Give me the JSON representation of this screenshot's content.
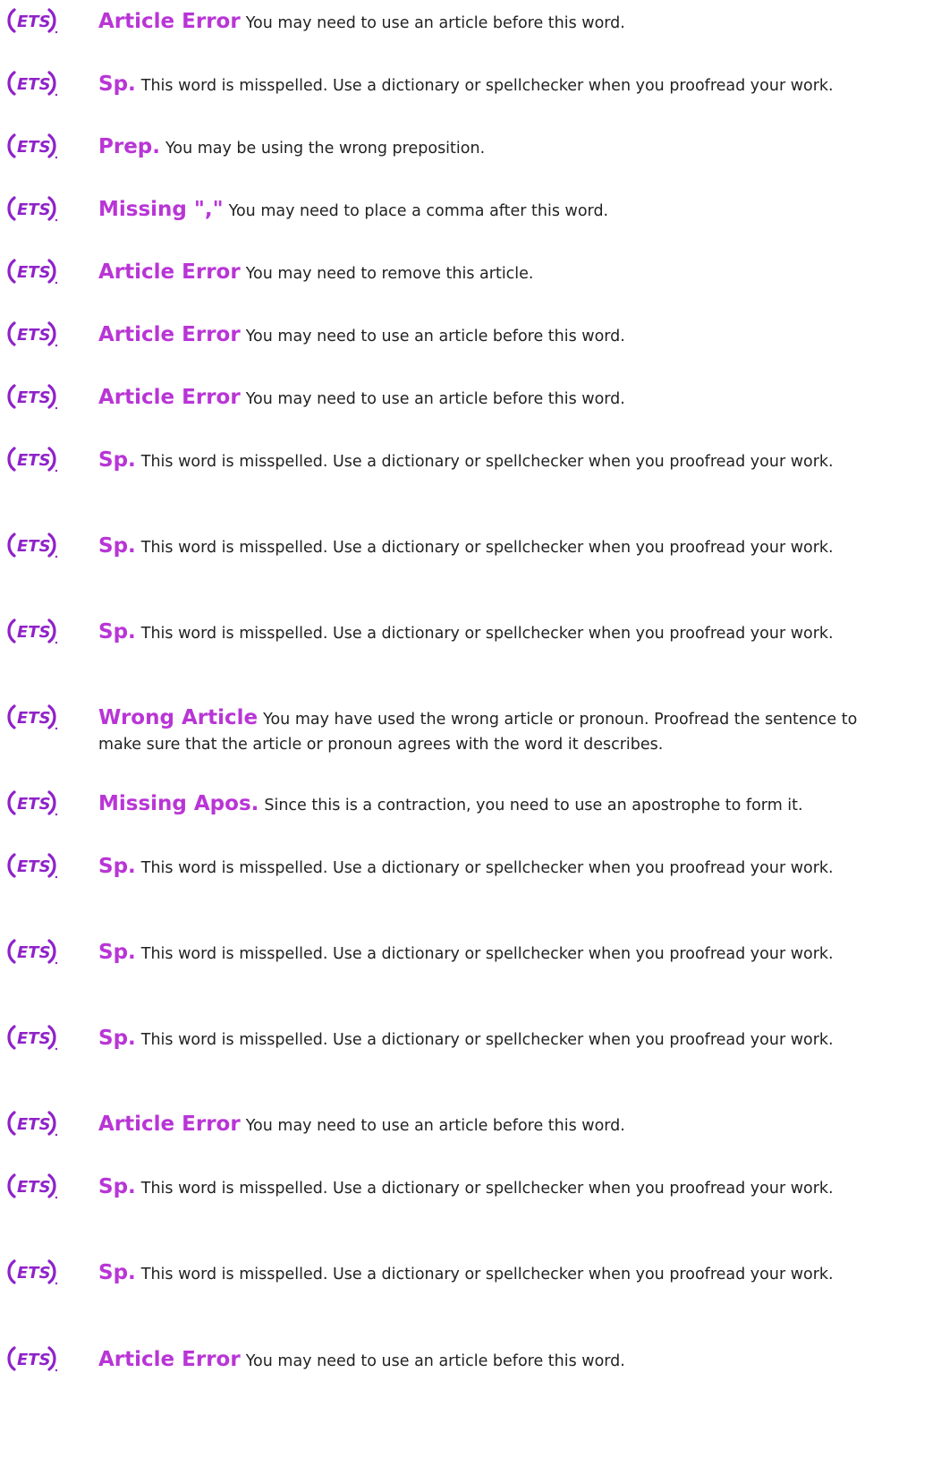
{
  "brand": {
    "logo_text": "ETS",
    "logo_color": "#8f22c9",
    "category_color": "#b935d6",
    "text_color": "#222222"
  },
  "items": [
    {
      "category": "Article Error",
      "message": "You may need to use an article before this word."
    },
    {
      "category": "Sp.",
      "message": "This word is misspelled. Use a dictionary or spellchecker when you proofread your work."
    },
    {
      "category": "Prep.",
      "message": "You may be using the wrong preposition."
    },
    {
      "category": "Missing \",\"",
      "message": "You may need to place a comma after this word."
    },
    {
      "category": "Article Error",
      "message": "You may need to remove this article."
    },
    {
      "category": "Article Error",
      "message": "You may need to use an article before this word."
    },
    {
      "category": "Article Error",
      "message": "You may need to use an article before this word."
    },
    {
      "category": "Sp.",
      "message": "This word is misspelled. Use a dictionary or spellchecker when you proofread your work."
    },
    {
      "category": "Sp.",
      "message": "This word is misspelled. Use a dictionary or spellchecker when you proofread your work."
    },
    {
      "category": "Sp.",
      "message": "This word is misspelled. Use a dictionary or spellchecker when you proofread your work."
    },
    {
      "category": "Wrong Article",
      "message": "You may have used the wrong article or pronoun. Proofread the sentence to make sure that the article or pronoun agrees with the word it describes."
    },
    {
      "category": "Missing Apos.",
      "message": "Since this is a contraction, you need to use an apostrophe to form it."
    },
    {
      "category": "Sp.",
      "message": "This word is misspelled. Use a dictionary or spellchecker when you proofread your work."
    },
    {
      "category": "Sp.",
      "message": "This word is misspelled. Use a dictionary or spellchecker when you proofread your work."
    },
    {
      "category": "Sp.",
      "message": "This word is misspelled. Use a dictionary or spellchecker when you proofread your work."
    },
    {
      "category": "Article Error",
      "message": "You may need to use an article before this word."
    },
    {
      "category": "Sp.",
      "message": "This word is misspelled. Use a dictionary or spellchecker when you proofread your work."
    },
    {
      "category": "Sp.",
      "message": "This word is misspelled. Use a dictionary or spellchecker when you proofread your work."
    },
    {
      "category": "Article Error",
      "message": "You may need to use an article before this word."
    }
  ]
}
